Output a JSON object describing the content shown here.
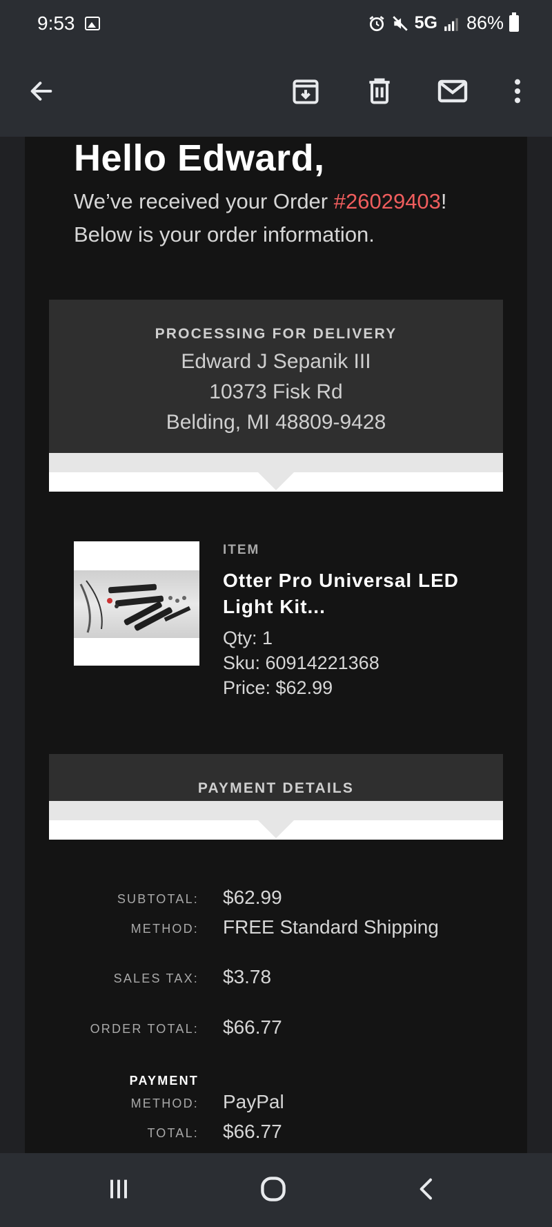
{
  "status_bar": {
    "time": "9:53",
    "network": "5G",
    "battery": "86%",
    "icons": [
      "image-icon",
      "alarm-icon",
      "mute-icon",
      "signal-icon",
      "battery-icon"
    ]
  },
  "app_bar": {
    "icons": [
      "back-arrow-icon",
      "archive-icon",
      "delete-icon",
      "mark-unread-icon",
      "more-options-icon"
    ]
  },
  "email": {
    "greeting": "Hello Edward,",
    "intro_prefix": "We’ve received your Order ",
    "order_number": "#26029403",
    "intro_suffix": "!",
    "intro_line2": "Below is your order information.",
    "order_number_color": "#ef5d5d",
    "delivery": {
      "heading": "PROCESSING FOR DELIVERY",
      "name": "Edward J Sepanik III",
      "street": "10373 Fisk Rd",
      "city_state_zip": "Belding, MI 48809-9428"
    },
    "item": {
      "label": "ITEM",
      "name_line1": "Otter Pro Universal LED",
      "name_line2": "Light Kit...",
      "qty": "Qty: 1",
      "sku": "Sku: 60914221368",
      "price": "Price: $62.99"
    },
    "payment_details": {
      "heading": "PAYMENT DETAILS",
      "subtotal_label": "SUBTOTAL:",
      "subtotal_value": "$62.99",
      "shipping_method_label": "METHOD:",
      "shipping_method_value": "FREE Standard Shipping",
      "sales_tax_label": "SALES TAX:",
      "sales_tax_value": "$3.78",
      "order_total_label": "ORDER TOTAL:",
      "order_total_value": "$66.77",
      "payment_heading": "PAYMENT",
      "payment_method_label": "METHOD:",
      "payment_method_value": "PayPal",
      "payment_total_label": "TOTAL:",
      "payment_total_value": "$66.77"
    }
  },
  "nav_bar": {
    "icons": [
      "recent-apps-icon",
      "home-icon",
      "back-icon"
    ]
  }
}
